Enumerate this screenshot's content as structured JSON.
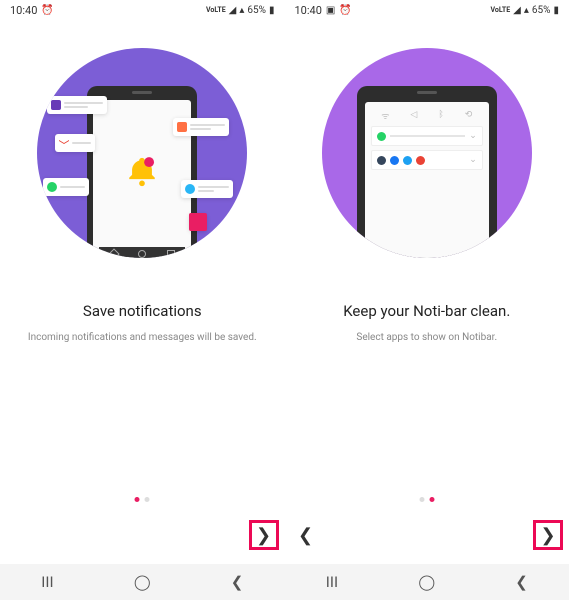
{
  "status": {
    "time": "10:40",
    "battery": "65%",
    "signal_label": "VoLTE"
  },
  "screens": [
    {
      "title": "Save notifications",
      "subtitle": "Incoming notifications and messages will be saved.",
      "page_index": 0,
      "accent_color": "#7c5ed6",
      "has_prev": false,
      "has_next": true,
      "next_highlighted": true
    },
    {
      "title": "Keep your Noti-bar clean.",
      "subtitle": "Select apps to show on Notibar.",
      "page_index": 1,
      "accent_color": "#a968e8",
      "has_prev": true,
      "has_next": true,
      "next_highlighted": true
    }
  ],
  "pager": {
    "total": 2
  },
  "illustration_icons": {
    "left": [
      "purple-square",
      "gmail",
      "whatsapp",
      "orange-square",
      "telegram",
      "pink-square",
      "bell"
    ],
    "right": [
      "wifi",
      "whatsapp",
      "tumblr",
      "facebook",
      "twitter",
      "gmail"
    ]
  }
}
